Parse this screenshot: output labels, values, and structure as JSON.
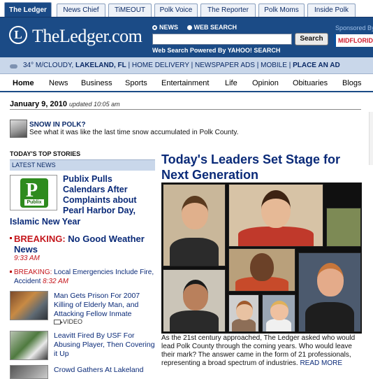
{
  "tabs": [
    {
      "label": "The Ledger",
      "active": true
    },
    {
      "label": "News Chief"
    },
    {
      "label": "TiMEOUT"
    },
    {
      "label": "Polk Voice"
    },
    {
      "label": "The Reporter"
    },
    {
      "label": "Polk Moms"
    },
    {
      "label": "Inside Polk"
    }
  ],
  "header": {
    "logo_letter": "L",
    "logo_text": "TheLedger.com",
    "search_option_news": "NEWS",
    "search_option_web": "WEB SEARCH",
    "search_button": "Search",
    "powered_by": "Web Search Powered By YAHOO! SEARCH",
    "sponsored": "Sponsored By",
    "sponsor": "MIDFLORIDA"
  },
  "infobar": {
    "weather": "34° M/CLOUDY,",
    "location": "LAKELAND, FL",
    "links": [
      "HOME DELIVERY",
      "NEWSPAPER ADS",
      "MOBILE"
    ],
    "last_link": "PLACE AN AD",
    "separator": "|"
  },
  "nav": [
    "Home",
    "News",
    "Business",
    "Sports",
    "Entertainment",
    "Life",
    "Opinion",
    "Obituaries",
    "Blogs"
  ],
  "dateline": {
    "date": "January 9, 2010",
    "updated": "updated 10:05 am"
  },
  "promo": {
    "title": "SNOW IN POLK?",
    "text": "See what it was like the last time snow accumulated in Polk County."
  },
  "left": {
    "section_title": "TODAY'S TOP STORIES",
    "latest_label": "LATEST NEWS",
    "publix_word": "Publix",
    "publix_letter": "P",
    "lead_story_a": "Publix Pulls Calendars After Complaints about Pearl Harbor Day,",
    "lead_story_b": "Islamic New Year",
    "breaking1_label": "BREAKING:",
    "breaking1_text": "No Good Weather News",
    "breaking1_time": "9:33 AM",
    "breaking2_label": "BREAKING:",
    "breaking2_text": "Local Emergencies Include Fire, Accident",
    "breaking2_time": "8:32 AM",
    "story1": "Man Gets Prison For 2007 Killing of Elderly Man, and Attacking Fellow Inmate",
    "story1_tag": "VIDEO",
    "story2": "Leavitt Fired By USF For Abusing Player, Then Covering it Up",
    "story3": "Crowd Gathers At Lakeland"
  },
  "feature": {
    "title": "Today's Leaders Set Stage for Next Generation",
    "caption": "As the 21st century approached, The Ledger asked who would lead Polk County through the coming years. Who would leave their mark? The answer came in the form of 21 professionals, representing a broad spectrum of industries.",
    "read_more": "READ MORE"
  },
  "colors": {
    "brand_blue": "#1b4b86",
    "link_blue": "#0a2a78",
    "breaking_red": "#c4161c",
    "publix_green": "#2e8b1e"
  }
}
